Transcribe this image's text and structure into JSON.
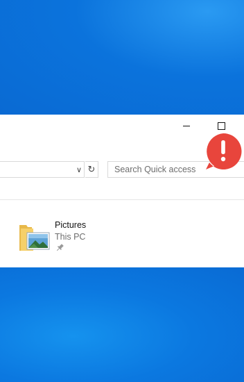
{
  "window": {
    "controls": {
      "minimize": "minimize",
      "maximize": "maximize"
    },
    "address_bar": {
      "dropdown_icon": "chevron-down-icon",
      "refresh_icon": "refresh-icon"
    },
    "search": {
      "placeholder": "Search Quick access"
    },
    "quick_access": {
      "items": [
        {
          "name": "Pictures",
          "location": "This PC",
          "icon": "pictures-folder-icon",
          "pinned": true
        }
      ]
    }
  },
  "notification": {
    "icon": "exclamation-icon",
    "color": "#e8453c"
  },
  "colors": {
    "desktop": "#0b7be3",
    "window_bg": "#ffffff",
    "border": "#d9d9d9"
  }
}
